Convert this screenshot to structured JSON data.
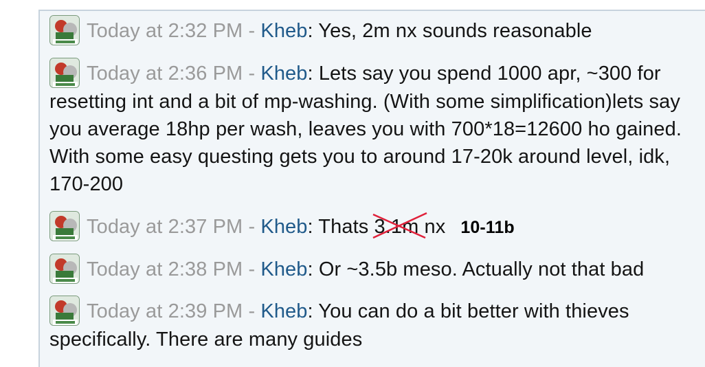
{
  "messages": [
    {
      "time": "Today at 2:32 PM",
      "separator": " - ",
      "author": "Kheb",
      "text": ": Yes, 2m nx sounds reasonable"
    },
    {
      "time": "Today at 2:36 PM",
      "separator": " - ",
      "author": "Kheb",
      "text": ": Lets say you spend 1000 apr, ~300 for resetting int and a bit of mp-washing. (With some simplification)lets say you average 18hp per wash, leaves you with 700*18=12600 ho gained. With some easy questing gets you to around 17-20k around level, idk, 170-200"
    },
    {
      "time": "Today at 2:37 PM",
      "separator": " - ",
      "author": "Kheb",
      "text_before": ": Thats ",
      "struck": "3.1m",
      "text_after": " nx",
      "note": "10-11b"
    },
    {
      "time": "Today at 2:38 PM",
      "separator": " - ",
      "author": "Kheb",
      "text": ": Or ~3.5b meso. Actually not that bad"
    },
    {
      "time": "Today at 2:39 PM",
      "separator": " - ",
      "author": "Kheb",
      "text": ": You can do a bit better with thieves specifically. There are many guides"
    }
  ],
  "avatar_icon": "avatar-image",
  "colors": {
    "author": "#205a8a",
    "timestamp": "#9a9a9a",
    "annotation_cross": "#e0203a"
  }
}
